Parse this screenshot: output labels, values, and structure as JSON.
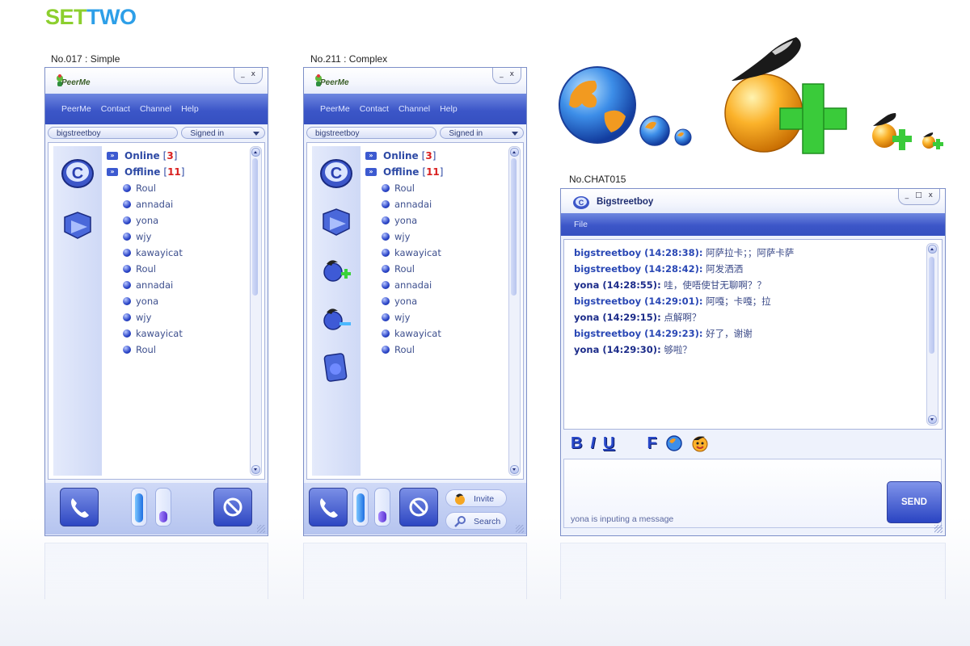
{
  "brand": {
    "part1": "SET",
    "part2": "TWO"
  },
  "captions": {
    "simple": "No.017 : Simple",
    "complex": "No.211 : Complex",
    "chat": "No.CHAT015"
  },
  "window_controls": {
    "minimize": "_",
    "maximize": "□",
    "close": "x"
  },
  "logo_text": "PeerMe",
  "menu": [
    "PeerMe",
    "Contact",
    "Channel",
    "Help"
  ],
  "user": {
    "name": "bigstreetboy",
    "status": "Signed in"
  },
  "groups": {
    "online": {
      "label": "Online",
      "open": "[",
      "count": "3",
      "close": "]"
    },
    "offline": {
      "label": "Offline",
      "open": "[",
      "count": "11",
      "close": "]"
    }
  },
  "contacts": [
    "Roul",
    "annadai",
    "yona",
    "wjy",
    "kawayicat",
    "Roul",
    "annadai",
    "yona",
    "wjy",
    "kawayicat",
    "Roul"
  ],
  "buttons": {
    "invite": "Invite",
    "search": "Search"
  },
  "chat": {
    "title": "Bigstreetboy",
    "menu_file": "File",
    "messages": [
      {
        "sender": "bigstreetboy (14:28:38):",
        "text": " 阿萨拉卡；；阿萨卡萨",
        "color": "#2a48b5"
      },
      {
        "sender": "bigstreetboy (14:28:42):",
        "text": " 阿发洒洒",
        "color": "#2a48b5"
      },
      {
        "sender": "yona (14:28:55):",
        "text": " 哇，使唔使甘无聊啊？？",
        "color": "#1c2c8a"
      },
      {
        "sender": "bigstreetboy (14:29:01):",
        "text": " 阿嘎；卡嘎；拉",
        "color": "#2a48b5"
      },
      {
        "sender": "yona (14:29:15):",
        "text": " 点解啊？",
        "color": "#1c2c8a"
      },
      {
        "sender": "bigstreetboy (14:29:23):",
        "text": " 好了，谢谢",
        "color": "#2a48b5"
      },
      {
        "sender": "yona (14:29:30):",
        "text": " 够啦？",
        "color": "#1c2c8a"
      }
    ],
    "format": {
      "bold": "B",
      "italic": "I",
      "underline": "U",
      "font": "F"
    },
    "send_label": "SEND",
    "status": "yona is inputing a message"
  },
  "colors": {
    "accent": "#3c56c8",
    "brand_green": "#8ccf2e",
    "brand_blue": "#2d9fe8",
    "offline_count": "#d92020"
  },
  "icons": {
    "big_globe": "globe-icon",
    "add_contact": "add-contact-icon",
    "phone": "phone-icon",
    "block": "block-icon",
    "chat_c": "chat-logo-icon"
  }
}
